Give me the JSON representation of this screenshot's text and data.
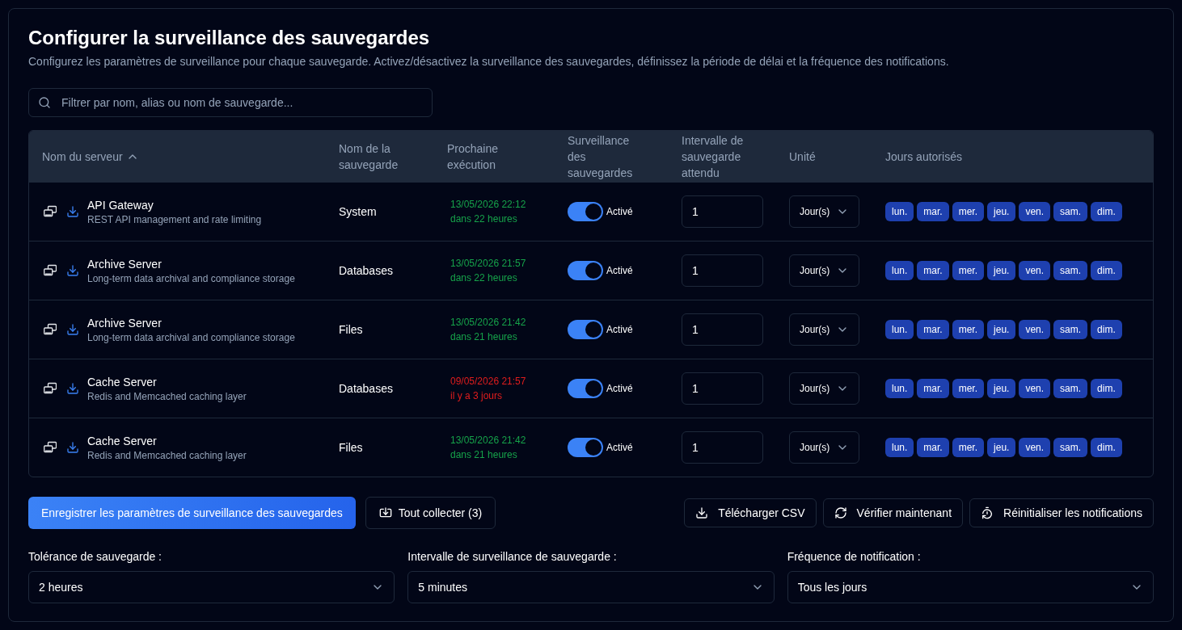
{
  "header": {
    "title": "Configurer la surveillance des sauvegardes",
    "description": "Configurez les paramètres de surveillance pour chaque sauvegarde. Activez/désactivez la surveillance des sauvegardes, définissez la période de délai et la fréquence des notifications."
  },
  "search": {
    "placeholder": "Filtrer par nom, alias ou nom de sauvegarde..."
  },
  "table": {
    "columns": [
      {
        "label": "Nom du serveur",
        "sorted": true
      },
      {
        "label": "Nom de la sauvegarde",
        "sorted": false
      },
      {
        "label": "Prochaine exécution",
        "sorted": false
      },
      {
        "label": "Surveillance des sauvegardes",
        "sorted": false
      },
      {
        "label": "Intervalle de sauvegarde attendu",
        "sorted": false
      },
      {
        "label": "Unité",
        "sorted": false
      },
      {
        "label": "Jours autorisés",
        "sorted": false
      }
    ],
    "rows": [
      {
        "server": "API Gateway",
        "description": "REST API management and rate limiting",
        "backup_name": "System",
        "next_run": {
          "date": "13/05/2026 22:12",
          "relative": "dans 22 heures",
          "overdue": false
        },
        "monitoring": {
          "on": true,
          "label": "Activé"
        },
        "interval": "1",
        "unit": "Jour(s)",
        "days": [
          {
            "label": "lun.",
            "selected": true
          },
          {
            "label": "mar.",
            "selected": true
          },
          {
            "label": "mer.",
            "selected": true
          },
          {
            "label": "jeu.",
            "selected": true
          },
          {
            "label": "ven.",
            "selected": true
          },
          {
            "label": "sam.",
            "selected": true
          },
          {
            "label": "dim.",
            "selected": true
          }
        ]
      },
      {
        "server": "Archive Server",
        "description": "Long-term data archival and compliance storage",
        "backup_name": "Databases",
        "next_run": {
          "date": "13/05/2026 21:57",
          "relative": "dans 22 heures",
          "overdue": false
        },
        "monitoring": {
          "on": true,
          "label": "Activé"
        },
        "interval": "1",
        "unit": "Jour(s)",
        "days": [
          {
            "label": "lun.",
            "selected": true
          },
          {
            "label": "mar.",
            "selected": true
          },
          {
            "label": "mer.",
            "selected": true
          },
          {
            "label": "jeu.",
            "selected": true
          },
          {
            "label": "ven.",
            "selected": true
          },
          {
            "label": "sam.",
            "selected": true
          },
          {
            "label": "dim.",
            "selected": true
          }
        ]
      },
      {
        "server": "Archive Server",
        "description": "Long-term data archival and compliance storage",
        "backup_name": "Files",
        "next_run": {
          "date": "13/05/2026 21:42",
          "relative": "dans 21 heures",
          "overdue": false
        },
        "monitoring": {
          "on": true,
          "label": "Activé"
        },
        "interval": "1",
        "unit": "Jour(s)",
        "days": [
          {
            "label": "lun.",
            "selected": true
          },
          {
            "label": "mar.",
            "selected": true
          },
          {
            "label": "mer.",
            "selected": true
          },
          {
            "label": "jeu.",
            "selected": true
          },
          {
            "label": "ven.",
            "selected": true
          },
          {
            "label": "sam.",
            "selected": true
          },
          {
            "label": "dim.",
            "selected": true
          }
        ]
      },
      {
        "server": "Cache Server",
        "description": "Redis and Memcached caching layer",
        "backup_name": "Databases",
        "next_run": {
          "date": "09/05/2026 21:57",
          "relative": "il y a 3 jours",
          "overdue": true
        },
        "monitoring": {
          "on": true,
          "label": "Activé"
        },
        "interval": "1",
        "unit": "Jour(s)",
        "days": [
          {
            "label": "lun.",
            "selected": true
          },
          {
            "label": "mar.",
            "selected": true
          },
          {
            "label": "mer.",
            "selected": true
          },
          {
            "label": "jeu.",
            "selected": true
          },
          {
            "label": "ven.",
            "selected": true
          },
          {
            "label": "sam.",
            "selected": true
          },
          {
            "label": "dim.",
            "selected": true
          }
        ]
      },
      {
        "server": "Cache Server",
        "description": "Redis and Memcached caching layer",
        "backup_name": "Files",
        "next_run": {
          "date": "13/05/2026 21:42",
          "relative": "dans 21 heures",
          "overdue": false
        },
        "monitoring": {
          "on": true,
          "label": "Activé"
        },
        "interval": "1",
        "unit": "Jour(s)",
        "days": [
          {
            "label": "lun.",
            "selected": true
          },
          {
            "label": "mar.",
            "selected": true
          },
          {
            "label": "mer.",
            "selected": true
          },
          {
            "label": "jeu.",
            "selected": true
          },
          {
            "label": "ven.",
            "selected": true
          },
          {
            "label": "sam.",
            "selected": true
          },
          {
            "label": "dim.",
            "selected": true
          }
        ]
      }
    ]
  },
  "actions_left": [
    {
      "label": "Enregistrer les paramètres de surveillance des sauvegardes",
      "kind": "primary"
    },
    {
      "label": "Tout collecter (3)",
      "kind": "outline"
    }
  ],
  "actions_right": [
    {
      "label": "Télécharger CSV"
    },
    {
      "label": "Vérifier maintenant"
    },
    {
      "label": "Réinitialiser les notifications"
    }
  ],
  "settings": [
    {
      "label": "Tolérance de sauvegarde :",
      "value": "2 heures"
    },
    {
      "label": "Intervalle de surveillance de sauvegarde :",
      "value": "5 minutes"
    },
    {
      "label": "Fréquence de notification :",
      "value": "Tous les jours"
    }
  ]
}
